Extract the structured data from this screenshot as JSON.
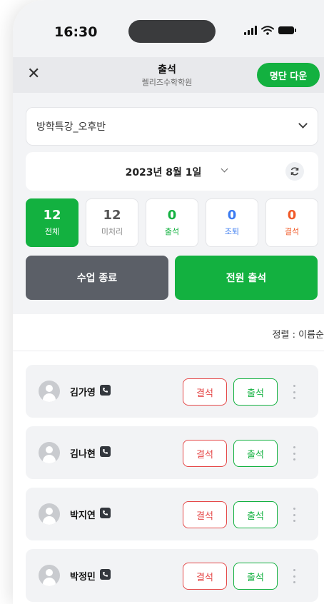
{
  "status_bar": {
    "time": "16:30"
  },
  "header": {
    "title": "출석",
    "subtitle": "렐리즈수학학원",
    "download_label": "명단 다운"
  },
  "class_select": {
    "value": "방학특강_오후반"
  },
  "date": {
    "value": "2023년 8월 1일"
  },
  "stats": [
    {
      "num": "12",
      "label": "전체",
      "color": "#ffffff"
    },
    {
      "num": "12",
      "label": "미처리",
      "color": "#555555"
    },
    {
      "num": "0",
      "label": "출석",
      "color": "#13b140"
    },
    {
      "num": "0",
      "label": "조퇴",
      "color": "#3a7bf0"
    },
    {
      "num": "0",
      "label": "결석",
      "color": "#f05a28"
    }
  ],
  "actions": {
    "end_class": "수업 종료",
    "all_present": "전원 출석"
  },
  "sort": {
    "label": "정렬 : 이름순"
  },
  "students": [
    {
      "name": "김가영",
      "absent": "결석",
      "present": "출석"
    },
    {
      "name": "김나현",
      "absent": "결석",
      "present": "출석"
    },
    {
      "name": "박지연",
      "absent": "결석",
      "present": "출석"
    },
    {
      "name": "박정민",
      "absent": "결석",
      "present": "출석"
    }
  ],
  "colors": {
    "accent": "#13b140",
    "absent": "#e54848",
    "dark_button": "#5b5f67"
  }
}
